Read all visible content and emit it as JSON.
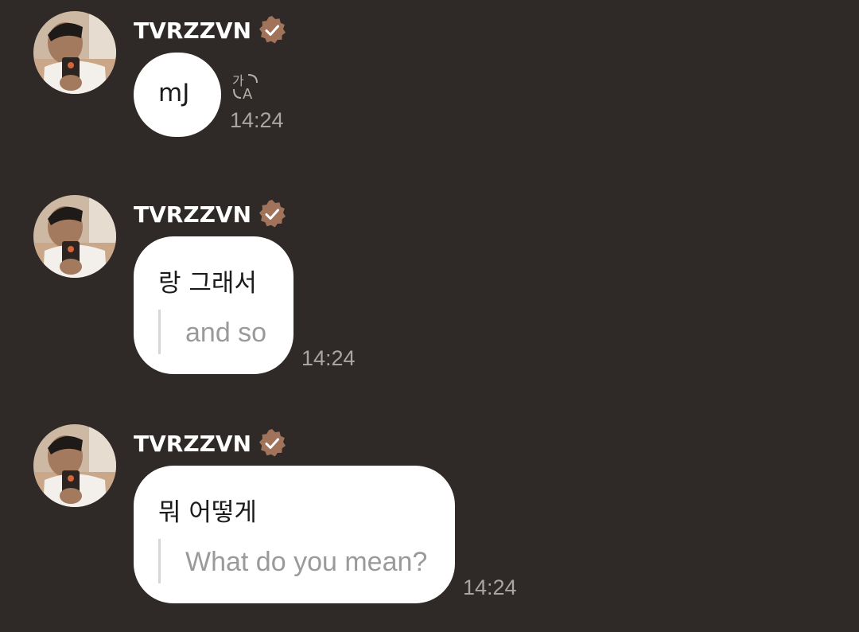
{
  "sender": {
    "name": "TVRZZVN",
    "avatar_icon": "profile-photo",
    "verified_icon": "verified-badge-icon",
    "badge_color": "#a0735a"
  },
  "colors": {
    "background": "#2f2a27",
    "bubble": "#ffffff",
    "time_text": "#a9a5a2",
    "translation_text": "#9a9a9a"
  },
  "messages": [
    {
      "text": "mJ",
      "translation": "",
      "time": "14:24",
      "has_translate_icon": true,
      "translate_icon": "translate-icon"
    },
    {
      "text": "랑 그래서",
      "translation": "and so",
      "time": "14:24",
      "has_translate_icon": false
    },
    {
      "text": "뭐 어떻게",
      "translation": "What do you mean?",
      "time": "14:24",
      "has_translate_icon": false
    }
  ]
}
